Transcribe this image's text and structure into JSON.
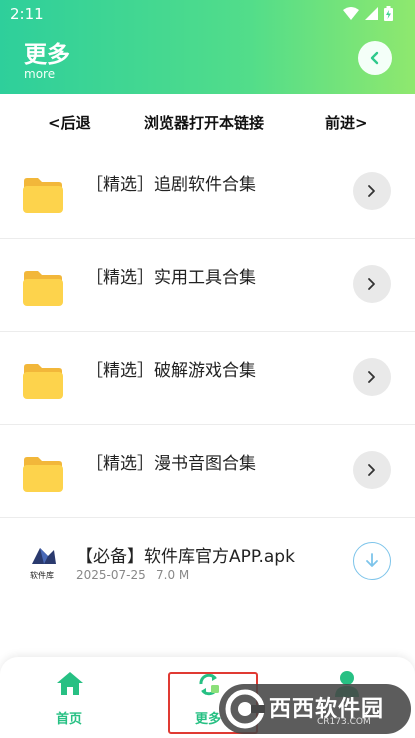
{
  "status_bar": {
    "time": "2:11"
  },
  "header": {
    "title": "更多",
    "subtitle": "more"
  },
  "nav": {
    "back": "<后退",
    "open_in_browser": "浏览器打开本链接",
    "forward": "前进>"
  },
  "list": [
    {
      "type": "folder",
      "title": "［精选］追剧软件合集"
    },
    {
      "type": "folder",
      "title": "［精选］实用工具合集"
    },
    {
      "type": "folder",
      "title": "［精选］破解游戏合集"
    },
    {
      "type": "folder",
      "title": "［精选］漫书音图合集"
    }
  ],
  "file": {
    "title": "【必备】软件库官方APP.apk",
    "date": "2025-07-25",
    "size": "7.0 M",
    "logo_text": "软件库"
  },
  "tabbar": {
    "home": "首页",
    "more": "更多",
    "active": "more"
  },
  "watermark": {
    "main": "西西软件园",
    "sub": "CR173.COM"
  },
  "colors": {
    "accent": "#27c083",
    "header_start": "#2ecf9b",
    "header_end": "#8fe86e",
    "folder": "#fdd34c",
    "highlight": "#e03a33",
    "download": "#7dc4ea"
  },
  "icons": {
    "back": "chevron-left-icon",
    "row_arrow": "chevron-right-icon",
    "folder": "folder-icon",
    "download": "download-icon",
    "home": "home-icon",
    "more": "refresh-icon",
    "mine": "user-icon"
  }
}
